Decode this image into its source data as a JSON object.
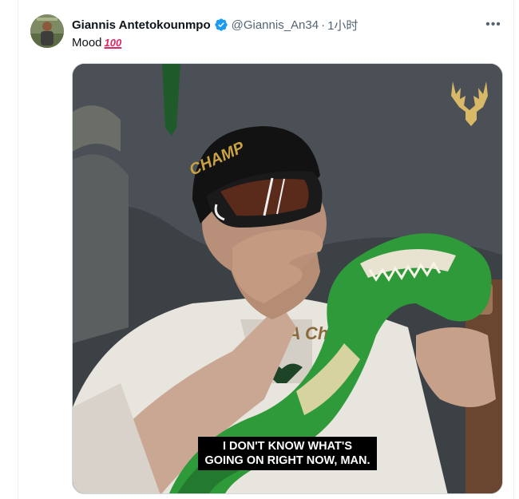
{
  "tweet": {
    "author_name": "Giannis Antetokounmpo",
    "handle": "@Giannis_An34",
    "separator": "·",
    "time": "1小时",
    "more_label": "•••",
    "text": "Mood",
    "emoji": "100"
  },
  "media": {
    "hat_text": "CHAMP",
    "shirt_text": "NBA Champs",
    "caption_line1": "I DON'T KNOW WHAT'S",
    "caption_line2": "GOING ON RIGHT NOW, MAN."
  },
  "colors": {
    "verified": "#1d9bf0",
    "secondary_text": "#536471",
    "logo_gold": "#d9b867",
    "dino_green": "#2e9a3a"
  },
  "icons": {
    "verified": "verified-badge-icon",
    "more": "more-options-icon",
    "logo": "bucks-deer-logo-icon"
  }
}
